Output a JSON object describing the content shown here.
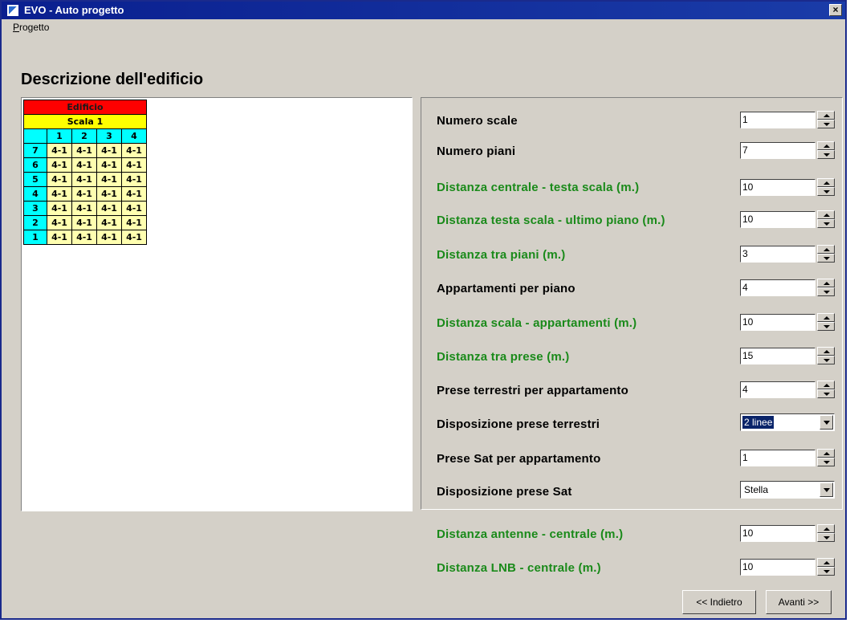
{
  "window": {
    "title": "EVO - Auto progetto",
    "close_label": "×"
  },
  "menu": {
    "items": [
      {
        "mnemonic": "P",
        "rest": "rogetto"
      }
    ]
  },
  "heading": "Descrizione dell'edificio",
  "preview": {
    "building_label": "Edificio",
    "stair_label": "Scala 1",
    "columns": [
      "1",
      "2",
      "3",
      "4"
    ],
    "rows": [
      {
        "floor": "7",
        "cells": [
          "4-1",
          "4-1",
          "4-1",
          "4-1"
        ]
      },
      {
        "floor": "6",
        "cells": [
          "4-1",
          "4-1",
          "4-1",
          "4-1"
        ]
      },
      {
        "floor": "5",
        "cells": [
          "4-1",
          "4-1",
          "4-1",
          "4-1"
        ]
      },
      {
        "floor": "4",
        "cells": [
          "4-1",
          "4-1",
          "4-1",
          "4-1"
        ]
      },
      {
        "floor": "3",
        "cells": [
          "4-1",
          "4-1",
          "4-1",
          "4-1"
        ]
      },
      {
        "floor": "2",
        "cells": [
          "4-1",
          "4-1",
          "4-1",
          "4-1"
        ]
      },
      {
        "floor": "1",
        "cells": [
          "4-1",
          "4-1",
          "4-1",
          "4-1"
        ]
      }
    ],
    "colors": {
      "building": "#ff0000",
      "stair": "#ffff00",
      "header": "#00ffff",
      "apartment": "#ffffb0"
    }
  },
  "fields": {
    "numero_scale": {
      "label": "Numero scale",
      "value": "1",
      "color": "black"
    },
    "numero_piani": {
      "label": "Numero piani",
      "value": "7",
      "color": "black"
    },
    "dist_centrale_testa": {
      "label": "Distanza centrale - testa scala (m.)",
      "value": "10",
      "color": "green"
    },
    "dist_testa_ultimo": {
      "label": "Distanza testa scala - ultimo piano (m.)",
      "value": "10",
      "color": "green"
    },
    "dist_piani": {
      "label": "Distanza tra piani (m.)",
      "value": "3",
      "color": "green"
    },
    "appartamenti": {
      "label": "Appartamenti per piano",
      "value": "4",
      "color": "black"
    },
    "dist_scala_app": {
      "label": "Distanza scala - appartamenti (m.)",
      "value": "10",
      "color": "green"
    },
    "dist_prese": {
      "label": "Distanza tra prese (m.)",
      "value": "15",
      "color": "green"
    },
    "prese_terrestri": {
      "label": "Prese terrestri per appartamento",
      "value": "4",
      "color": "black"
    },
    "disp_terrestri": {
      "label": "Disposizione prese terrestri",
      "value": "2 linee",
      "color": "black"
    },
    "prese_sat": {
      "label": "Prese Sat per appartamento",
      "value": "1",
      "color": "black"
    },
    "disp_sat": {
      "label": "Disposizione prese Sat",
      "value": "Stella",
      "color": "black"
    },
    "dist_antenne": {
      "label": "Distanza antenne - centrale (m.)",
      "value": "10",
      "color": "green"
    },
    "dist_lnb": {
      "label": "Distanza LNB - centrale (m.)",
      "value": "10",
      "color": "green"
    }
  },
  "buttons": {
    "back": "<< Indietro",
    "next": "Avanti >>"
  },
  "colors": {
    "label_green": "#1a8a1a",
    "titlebar": "#0a1f8f",
    "window_bg": "#d4d0c8"
  }
}
